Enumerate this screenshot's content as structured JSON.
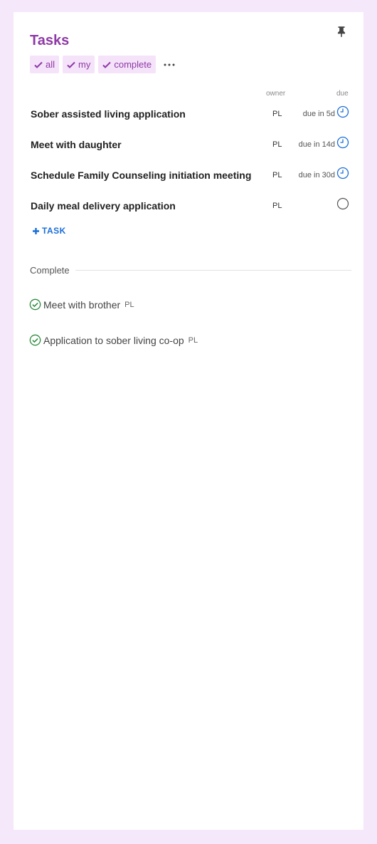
{
  "header": {
    "title": "Tasks"
  },
  "filters": [
    {
      "label": "all"
    },
    {
      "label": "my"
    },
    {
      "label": "complete"
    }
  ],
  "columns": {
    "owner": "owner",
    "due": "due"
  },
  "tasks": [
    {
      "name": "Sober assisted living application",
      "owner": "PL",
      "due": "due in 5d",
      "icon": "clock-icon"
    },
    {
      "name": "Meet with daughter",
      "owner": "PL",
      "due": "due in 14d",
      "icon": "clock-icon"
    },
    {
      "name": "Schedule Family Counseling initiation meeting",
      "owner": "PL",
      "due": "due in 30d",
      "icon": "clock-icon"
    },
    {
      "name": "Daily meal delivery application",
      "owner": "PL",
      "due": "",
      "icon": "circle-icon"
    }
  ],
  "add_task": {
    "label": "TASK"
  },
  "complete_section": {
    "label": "Complete",
    "items": [
      {
        "name": "Meet with brother",
        "owner": "PL"
      },
      {
        "name": "Application to sober living co-op",
        "owner": "PL"
      }
    ]
  },
  "colors": {
    "accent": "#8e3aa6",
    "chip_bg": "#f5e3f9",
    "link": "#1b6ed8",
    "complete_green": "#2e8b3e",
    "page_bg": "#f6e8fb"
  }
}
